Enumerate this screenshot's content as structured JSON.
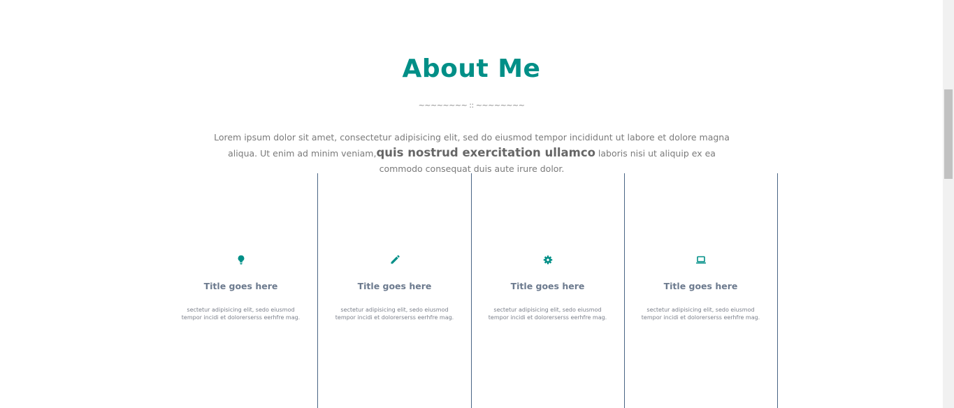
{
  "about": {
    "title": "About Me",
    "divider": "~~~~~~~~ :: ~~~~~~~~",
    "intro_part1": "Lorem ipsum dolor sit amet, consectetur adipisicing elit, sed do eiusmod tempor incididunt ut labore et dolore magna aliqua. Ut enim ad minim veniam,",
    "intro_strong": "quis nostrud exercitation ullamco",
    "intro_part2": " laboris nisi ut aliquip ex ea commodo consequat duis aute irure dolor."
  },
  "features": [
    {
      "icon": "lightbulb-icon",
      "title": "Title goes here",
      "description": "sectetur adipisicing elit, sedo eiusmod tempor incidi et dolorerserss eerhfre mag."
    },
    {
      "icon": "pencil-icon",
      "title": "Title goes here",
      "description": "sectetur adipisicing elit, sedo eiusmod tempor incidi et dolorerserss eerhfre mag."
    },
    {
      "icon": "gear-icon",
      "title": "Title goes here",
      "description": "sectetur adipisicing elit, sedo eiusmod tempor incidi et dolorerserss eerhfre mag."
    },
    {
      "icon": "laptop-icon",
      "title": "Title goes here",
      "description": "sectetur adipisicing elit, sedo eiusmod tempor incidi et dolorerserss eerhfre mag."
    }
  ],
  "colors": {
    "accent": "#008f87",
    "divider_line": "#4a6585",
    "feature_title": "#6c7a8e"
  }
}
